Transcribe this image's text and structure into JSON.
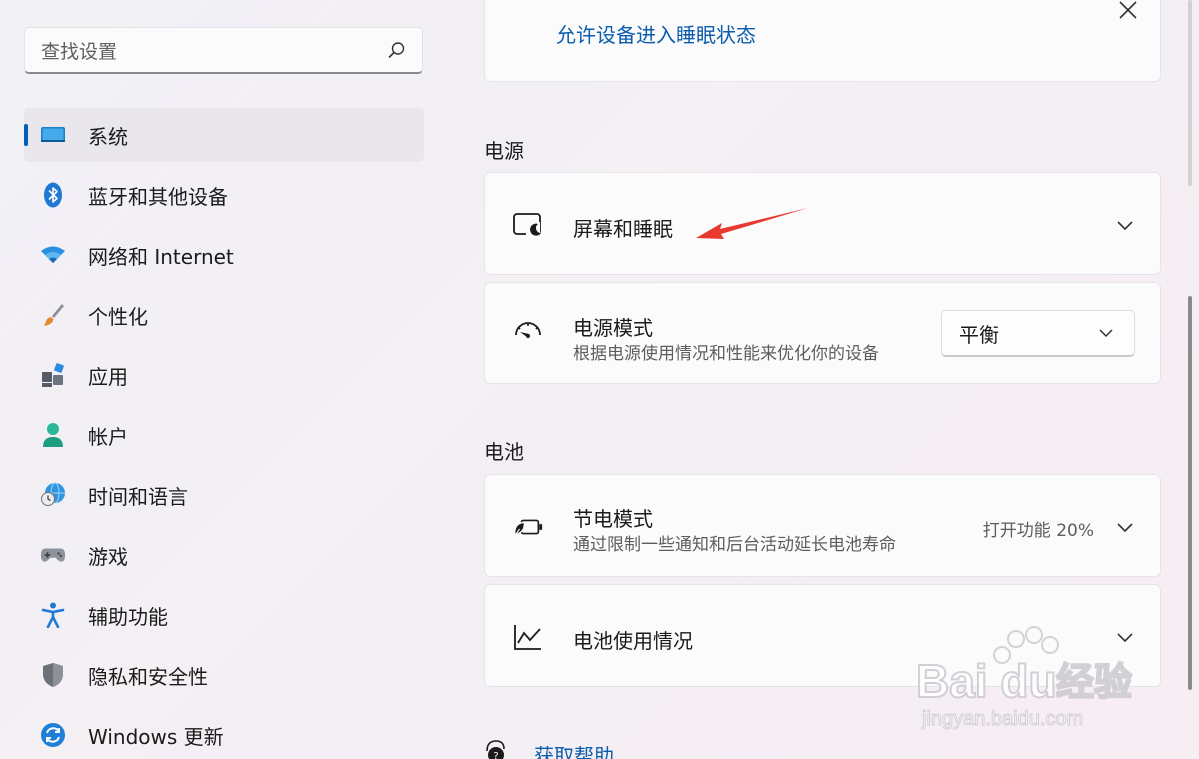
{
  "search": {
    "placeholder": "查找设置"
  },
  "sidebar": {
    "items": [
      {
        "label": "系统",
        "icon": "monitor-icon",
        "active": true
      },
      {
        "label": "蓝牙和其他设备",
        "icon": "bluetooth-icon"
      },
      {
        "label": "网络和 Internet",
        "icon": "wifi-icon"
      },
      {
        "label": "个性化",
        "icon": "brush-icon"
      },
      {
        "label": "应用",
        "icon": "apps-icon"
      },
      {
        "label": "帐户",
        "icon": "person-icon"
      },
      {
        "label": "时间和语言",
        "icon": "globe-clock-icon"
      },
      {
        "label": "游戏",
        "icon": "gamepad-icon"
      },
      {
        "label": "辅助功能",
        "icon": "accessibility-icon"
      },
      {
        "label": "隐私和安全性",
        "icon": "shield-icon"
      },
      {
        "label": "Windows 更新",
        "icon": "update-icon"
      }
    ]
  },
  "main": {
    "top_link": "允许设备进入睡眠状态",
    "power_section": "电源",
    "screen_sleep": {
      "title": "屏幕和睡眠",
      "icon": "screen-sleep-icon"
    },
    "power_mode": {
      "title": "电源模式",
      "subtitle": "根据电源使用情况和性能来优化你的设备",
      "value": "平衡",
      "icon": "gauge-icon"
    },
    "battery_section": "电池",
    "battery_saver": {
      "title": "节电模式",
      "subtitle": "通过限制一些通知和后台活动延长电池寿命",
      "status": "打开功能 20%",
      "icon": "battery-leaf-icon"
    },
    "battery_usage": {
      "title": "电池使用情况",
      "icon": "chart-line-icon"
    },
    "help_link": "获取帮助"
  },
  "watermark": {
    "brand": "Bai du",
    "cn": "经验",
    "url": "jingyan.baidu.com"
  },
  "colors": {
    "accent": "#005fb8",
    "link": "#0b5cad",
    "arrow": "#e8392f"
  }
}
